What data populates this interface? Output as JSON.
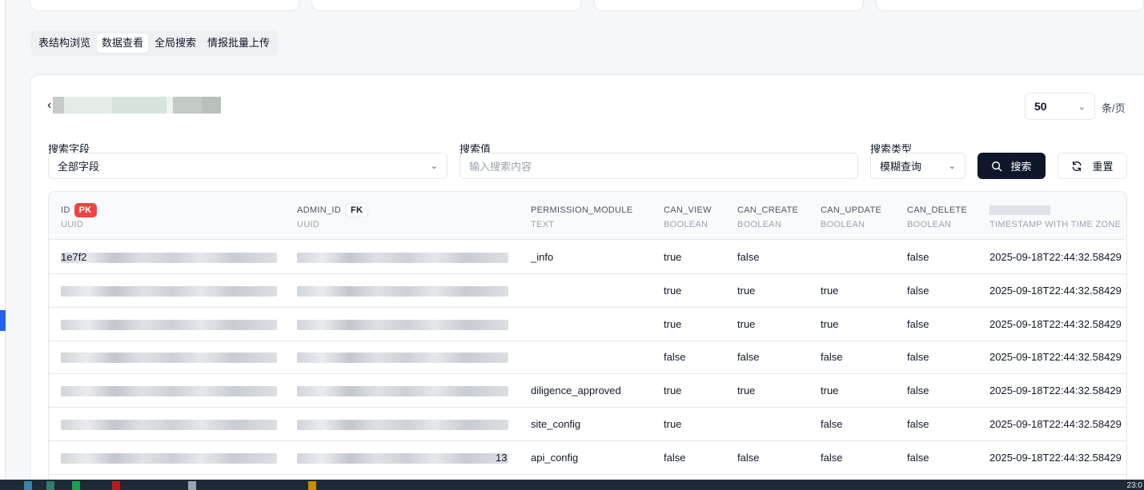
{
  "tabs": [
    {
      "label": "表结构浏览",
      "active": false
    },
    {
      "label": "数据查看",
      "active": true
    },
    {
      "label": "全局搜索",
      "active": false
    },
    {
      "label": "情报批量上传",
      "active": false
    }
  ],
  "pagination": {
    "page_size": "50",
    "suffix": "条/页"
  },
  "search": {
    "field_label": "搜索字段",
    "field_value": "全部字段",
    "value_label": "搜索值",
    "value_placeholder": "输入搜索内容",
    "type_label": "搜索类型",
    "type_value": "模糊查询",
    "search_button": "搜索",
    "reset_button": "重置"
  },
  "table": {
    "columns": [
      {
        "name": "ID",
        "type": "UUID",
        "badge": "PK"
      },
      {
        "name": "ADMIN_ID",
        "type": "UUID",
        "badge": "FK"
      },
      {
        "name": "PERMISSION_MODULE",
        "type": "TEXT"
      },
      {
        "name": "CAN_VIEW",
        "type": "BOOLEAN"
      },
      {
        "name": "CAN_CREATE",
        "type": "BOOLEAN"
      },
      {
        "name": "CAN_UPDATE",
        "type": "BOOLEAN"
      },
      {
        "name": "CAN_DELETE",
        "type": "BOOLEAN"
      },
      {
        "name": "",
        "type": "TIMESTAMP WITH TIME ZONE"
      }
    ],
    "rows": [
      {
        "id": "1e7f2",
        "admin_id": "",
        "module": "_info",
        "can_view": "true",
        "can_create": "false",
        "can_update": "",
        "can_delete": "false",
        "ts": "2025-09-18T22:44:32.58429"
      },
      {
        "id": "",
        "admin_id": "",
        "module": "",
        "can_view": "true",
        "can_create": "true",
        "can_update": "true",
        "can_delete": "false",
        "ts": "2025-09-18T22:44:32.58429"
      },
      {
        "id": "",
        "admin_id": "",
        "module": "",
        "can_view": "true",
        "can_create": "true",
        "can_update": "true",
        "can_delete": "false",
        "ts": "2025-09-18T22:44:32.58429"
      },
      {
        "id": "",
        "admin_id": "",
        "module": "",
        "can_view": "false",
        "can_create": "false",
        "can_update": "false",
        "can_delete": "false",
        "ts": "2025-09-18T22:44:32.58429"
      },
      {
        "id": "",
        "admin_id": "",
        "module": "diligence_approved",
        "can_view": "true",
        "can_create": "true",
        "can_update": "true",
        "can_delete": "false",
        "ts": "2025-09-18T22:44:32.58429"
      },
      {
        "id": "",
        "admin_id": "",
        "module": "site_config",
        "can_view": "true",
        "can_create": "",
        "can_update": "false",
        "can_delete": "false",
        "ts": "2025-09-18T22:44:32.58429"
      },
      {
        "id": "",
        "admin_id": "13",
        "module": "api_config",
        "can_view": "false",
        "can_create": "false",
        "can_update": "false",
        "can_delete": "false",
        "ts": "2025-09-18T22:44:32.58429"
      }
    ]
  },
  "taskbar": {
    "clock": "23:0"
  },
  "icons": {
    "search": "search-icon",
    "reset": "refresh-icon",
    "chevron": "chevron-down-icon",
    "back": "chevron-left-icon"
  },
  "colors": {
    "primary": "#0f172a",
    "pk_badge": "#ef4444",
    "accent": "#2563eb"
  }
}
